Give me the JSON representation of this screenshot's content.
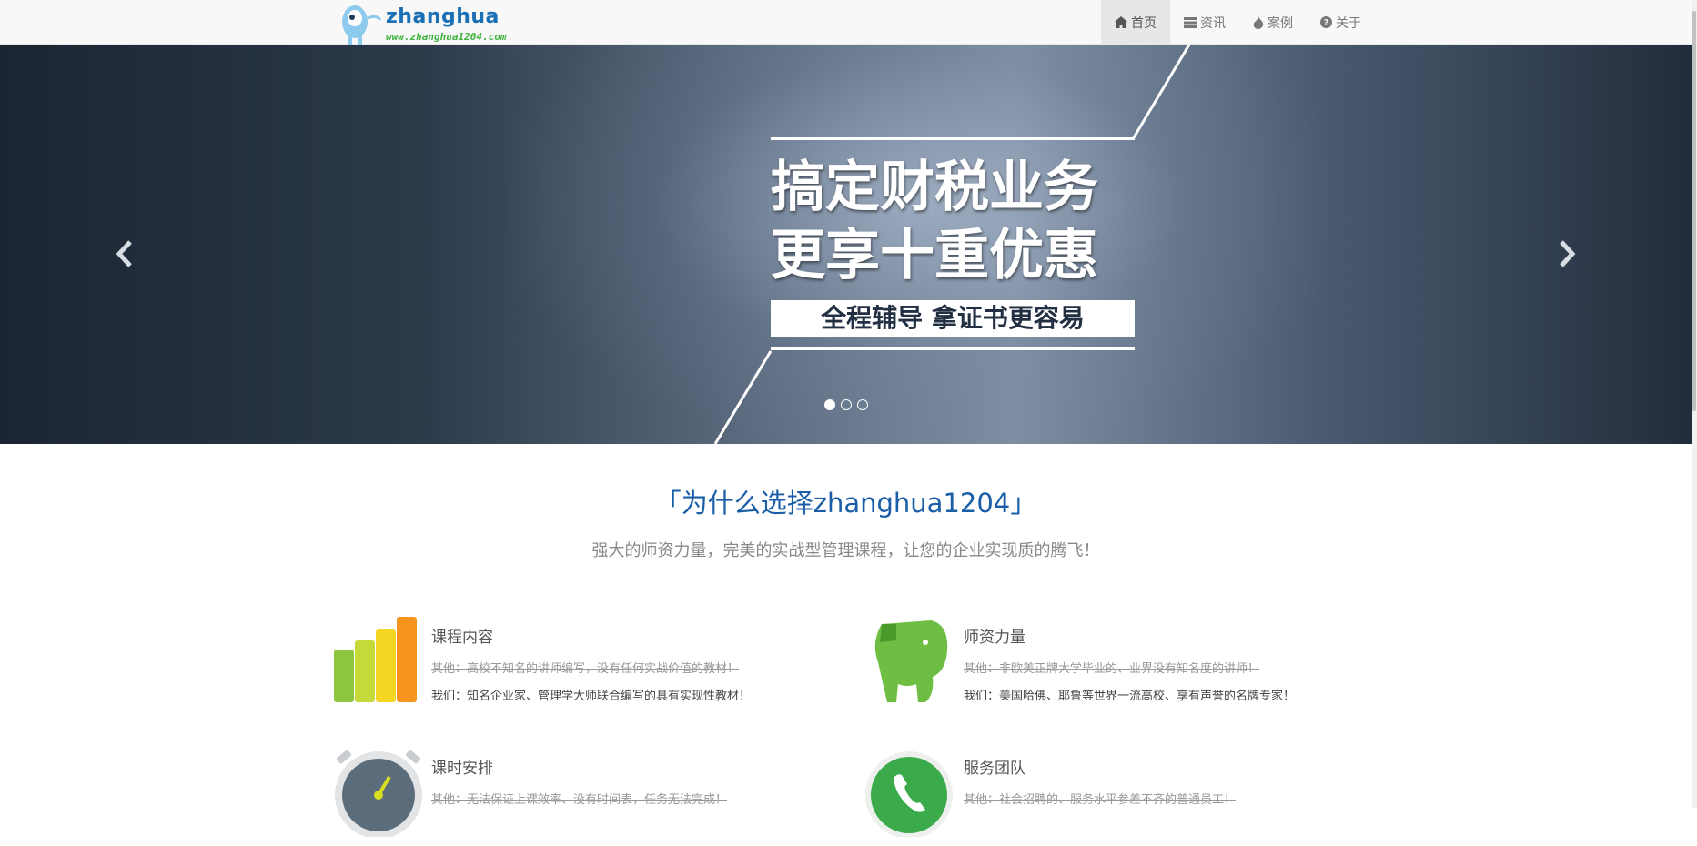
{
  "navbar": {
    "brand_name": "zhanghua",
    "brand_url": "www.zhanghua1204.com",
    "items": [
      {
        "label": "首页",
        "icon": "home-icon",
        "active": true
      },
      {
        "label": "资讯",
        "icon": "list-icon",
        "active": false
      },
      {
        "label": "案例",
        "icon": "fire-icon",
        "active": false
      },
      {
        "label": "关于",
        "icon": "question-circle-icon",
        "active": false
      }
    ]
  },
  "carousel": {
    "line1": "搞定财税业务",
    "line2": "更享十重优惠",
    "tagline": "全程辅导 拿证书更容易",
    "slide_count": 3,
    "active_index": 0
  },
  "intro": {
    "title": "「为什么选择zhanghua1204」",
    "subtitle": "强大的师资力量，完美的实战型管理课程，让您的企业实现质的腾飞！"
  },
  "features": [
    {
      "title": "课程内容",
      "old": "其他：高校不知名的讲师编写，没有任何实战价值的教材！",
      "new": "我们：知名企业家、管理学大师联合编写的具有实现性教材！",
      "icon": "bar-chart-icon"
    },
    {
      "title": "师资力量",
      "old": "其他：非欧美正牌大学毕业的、业界没有知名度的讲师！",
      "new": "我们：美国哈佛、耶鲁等世界一流高校、享有声誉的名牌专家！",
      "icon": "elephant-icon"
    },
    {
      "title": "课时安排",
      "old": "其他：无法保证上课效率、没有时间表，任务无法完成！",
      "new": "",
      "icon": "stopwatch-icon"
    },
    {
      "title": "服务团队",
      "old": "其他：社会招聘的、服务水平参差不齐的普通员工！",
      "new": "",
      "icon": "phone-icon"
    }
  ],
  "colors": {
    "accent": "#1a5ea8",
    "brand_green": "#3fb33f",
    "nav_bg": "#f8f8f8"
  }
}
